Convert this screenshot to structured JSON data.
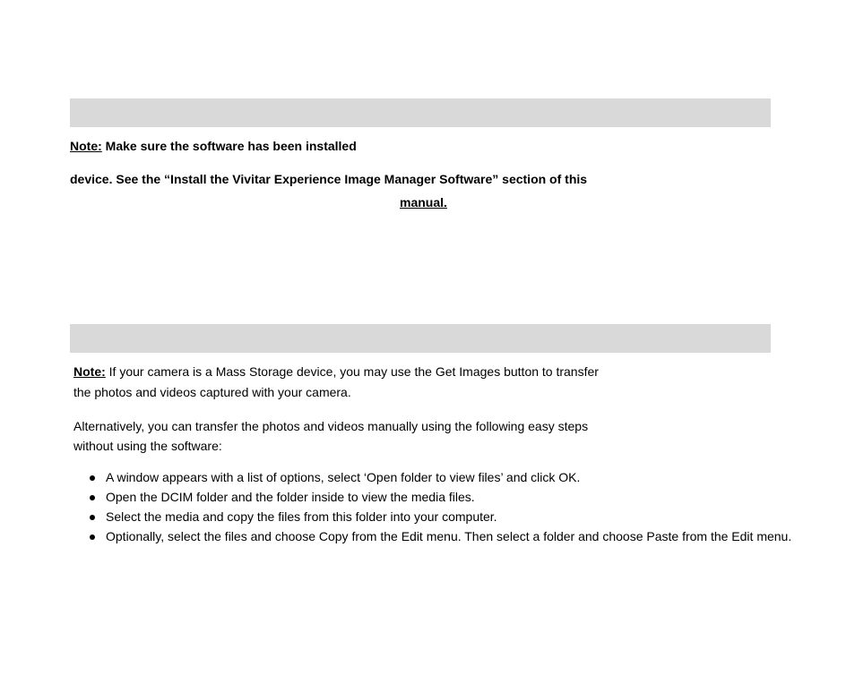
{
  "note1": {
    "prefix": "Note:",
    "line1_rest": " Make sure the software has been installed",
    "line2": "device. See the “Install the Vivitar Experience Image Manager Software” section of this",
    "line3": "manual."
  },
  "note2": {
    "prefix": "Note:",
    "line1_rest": " If your camera is a Mass Storage device, you may use the Get Images button to transfer",
    "line2": "the photos and videos captured with your camera.",
    "line3": "Alternatively, you can transfer the photos and videos manually using the following easy steps",
    "line4": "without using the software:",
    "bullets": [
      "A window appears with a list of options, select ‘Open folder to view files’ and click OK.",
      "Open the DCIM folder and the folder inside to view the media files.",
      "Select the media and copy the files from this folder into your computer.",
      "Optionally, select the files and choose Copy from the Edit menu. Then select a folder and choose Paste from the Edit menu."
    ]
  }
}
